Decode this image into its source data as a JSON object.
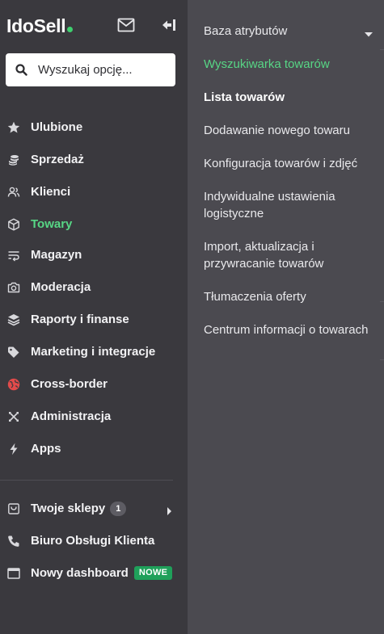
{
  "logo": {
    "ido": "Ido",
    "sell": "Sell"
  },
  "search": {
    "placeholder": "Wyszukaj opcję..."
  },
  "nav": {
    "items": [
      {
        "label": "Ulubione",
        "icon": "star-icon"
      },
      {
        "label": "Sprzedaż",
        "icon": "coins-icon"
      },
      {
        "label": "Klienci",
        "icon": "users-icon"
      },
      {
        "label": "Towary",
        "icon": "box-icon",
        "active": true
      },
      {
        "label": "Magazyn",
        "icon": "warehouse-icon"
      },
      {
        "label": "Moderacja",
        "icon": "camera-icon"
      },
      {
        "label": "Raporty i finanse",
        "icon": "layers-icon"
      },
      {
        "label": "Marketing i integracje",
        "icon": "tag-icon"
      },
      {
        "label": "Cross-border",
        "icon": "globe-icon"
      },
      {
        "label": "Administracja",
        "icon": "tools-icon"
      },
      {
        "label": "Apps",
        "icon": "bolt-icon"
      }
    ],
    "bottom": {
      "shops_label": "Twoje sklepy",
      "shops_count": "1",
      "support_label": "Biuro Obsługi Klienta",
      "dashboard_label": "Nowy dashboard",
      "dashboard_badge": "NOWE"
    }
  },
  "submenu": {
    "items": [
      {
        "label": "Baza atrybutów"
      },
      {
        "label": "Wyszukiwarka towarów",
        "state": "active"
      },
      {
        "label": "Lista towarów",
        "state": "current"
      },
      {
        "label": "Dodawanie nowego towaru"
      },
      {
        "label": "Konfiguracja towarów i zdjęć"
      },
      {
        "label": "Indywidualne ustawienia logistyczne"
      },
      {
        "label": "Import, aktualizacja i przywracanie towarów"
      },
      {
        "label": "Tłumaczenia oferty"
      },
      {
        "label": "Centrum informacji o towarach"
      }
    ]
  },
  "colors": {
    "accent": "#57d685",
    "sidebar_bg": "#3a393e",
    "submenu_bg": "#4b4a50",
    "cross_border_red": "#e24b4b",
    "new_badge_bg": "#1fa05a"
  }
}
